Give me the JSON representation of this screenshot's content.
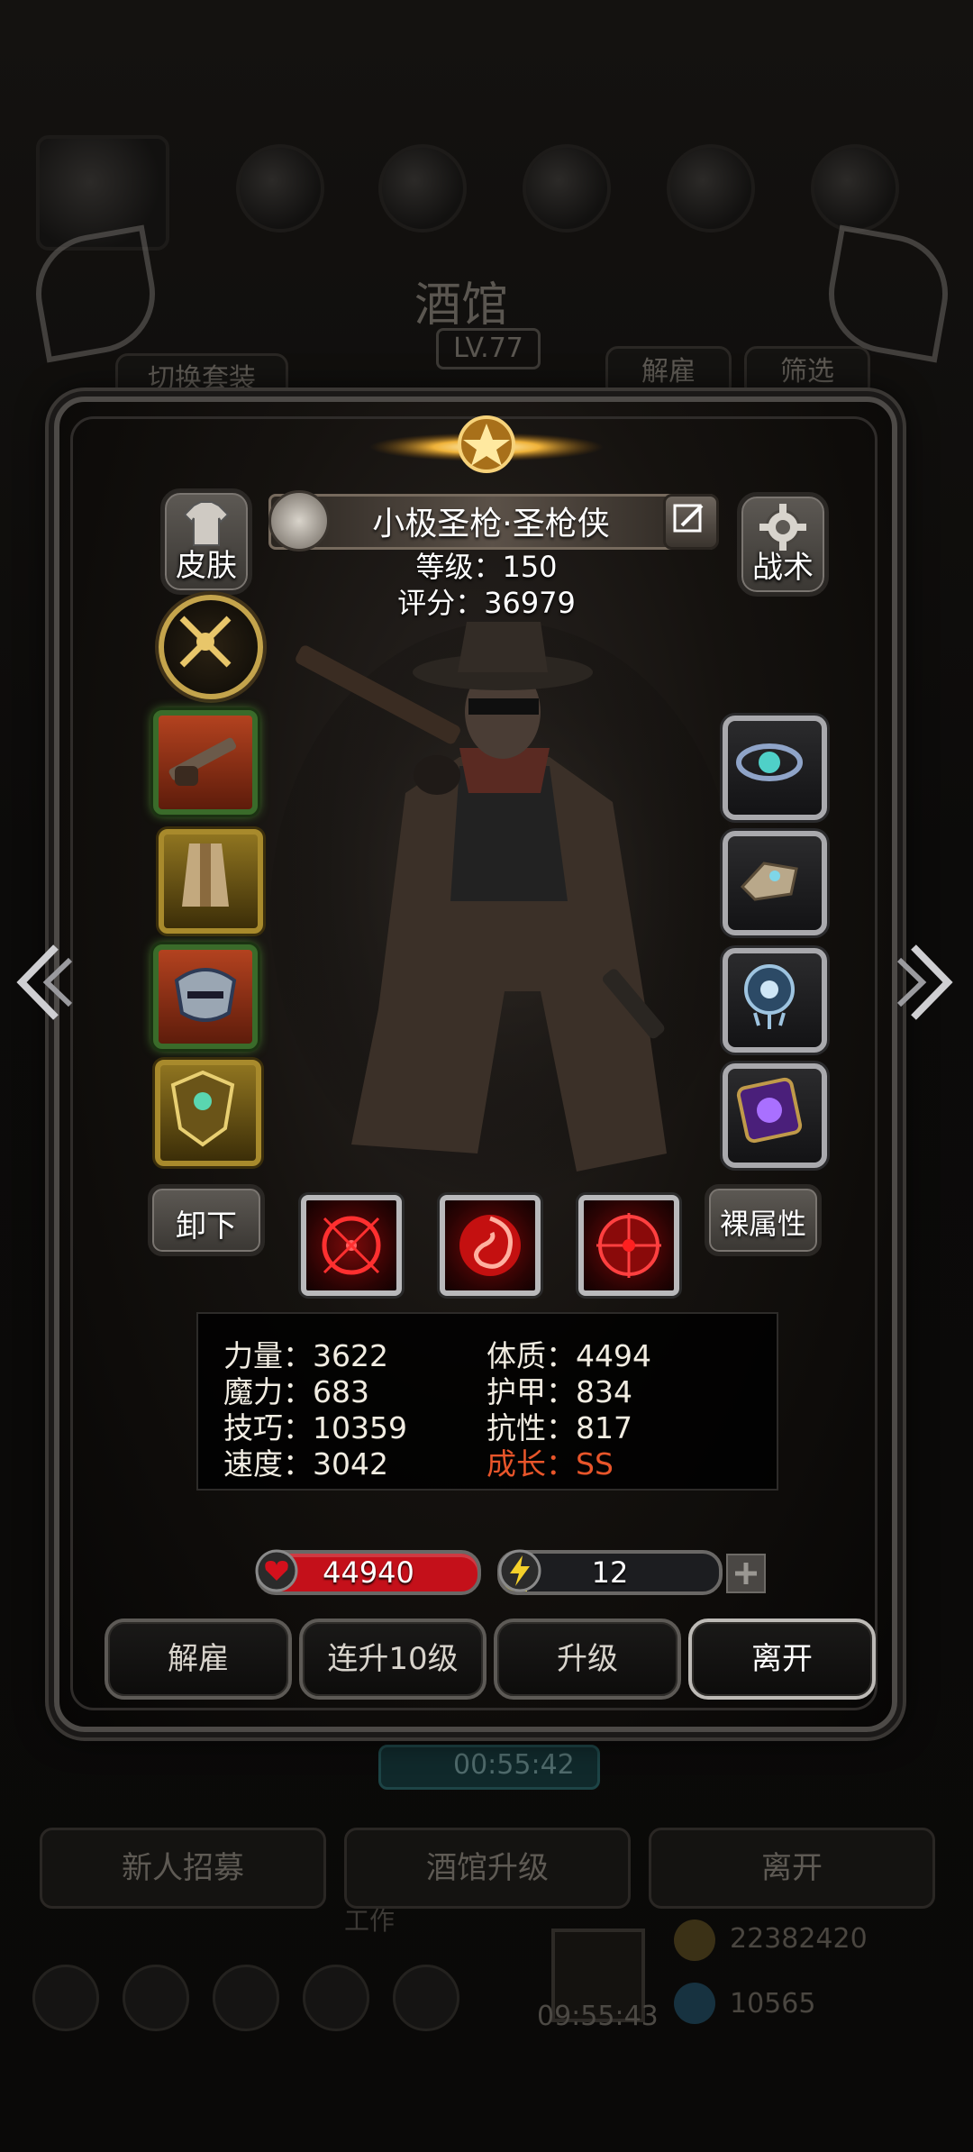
{
  "background": {
    "title": "酒馆",
    "level": "LV.77",
    "switch_outfit": "切换套装",
    "dismiss": "解雇",
    "filter": "筛选",
    "timer": "00:55:42",
    "bottom_buttons": [
      "新人招募",
      "酒馆升级",
      "离开"
    ],
    "work_label": "工作",
    "gold": "22382420",
    "gems": "10565",
    "gift_timer": "09:55:43"
  },
  "hero": {
    "name": "小极圣枪·圣枪侠",
    "level_label": "等级：150",
    "score_label": "评分：36979"
  },
  "buttons": {
    "skin": "皮肤",
    "tactics": "战术",
    "unequip": "卸下",
    "bare_stats": "裸属性"
  },
  "stats": {
    "left": [
      "力量：3622",
      "魔力：683",
      "技巧：10359",
      "速度：3042"
    ],
    "right": [
      "体质：4494",
      "护甲：834",
      "抗性：817"
    ],
    "growth": "成长：SS"
  },
  "bars": {
    "hp": "44940",
    "energy": "12",
    "energy_fill_percent": 12
  },
  "actions": [
    "解雇",
    "连升10级",
    "升级",
    "离开"
  ],
  "colors": {
    "hp_red": "#c4101a",
    "energy_yellow": "#e8d43a",
    "growth_orange": "#e8552a"
  },
  "icons": {
    "left_slots": [
      "musket-icon",
      "robe-icon",
      "mask-icon",
      "shield-crest-icon"
    ],
    "right_slots": [
      "amulet-icon",
      "bracer-icon",
      "orb-pendant-icon",
      "spell-tome-icon"
    ],
    "skills": [
      "crosshair-skill-icon",
      "swirl-skill-icon",
      "target-skill-icon"
    ]
  }
}
